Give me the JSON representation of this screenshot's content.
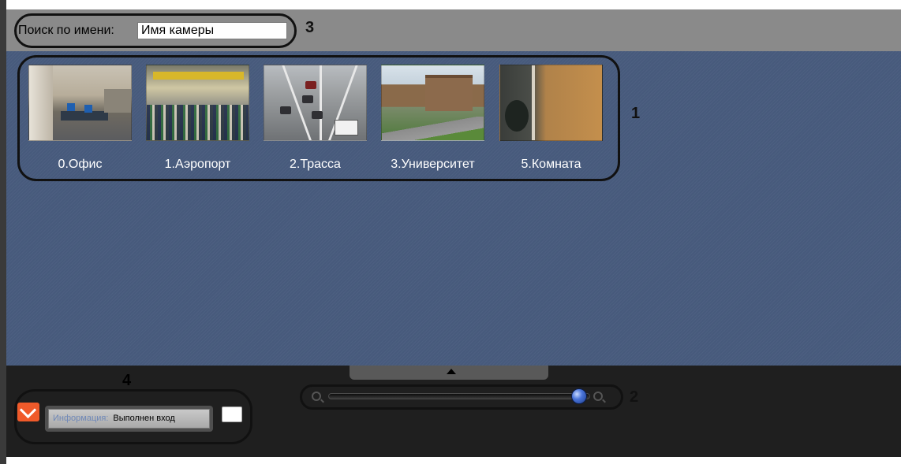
{
  "search": {
    "label": "Поиск по имени:",
    "value": "Имя камеры"
  },
  "cameras": [
    {
      "label": "0.Офис",
      "thumb": "office-camera-thumbnail"
    },
    {
      "label": "1.Аэропорт",
      "thumb": "airport-camera-thumbnail"
    },
    {
      "label": "2.Трасса",
      "thumb": "highway-camera-thumbnail"
    },
    {
      "label": "3.Университет",
      "thumb": "university-camera-thumbnail"
    },
    {
      "label": "5.Комната",
      "thumb": "room-camera-thumbnail"
    }
  ],
  "zoom": {
    "level": 0.93,
    "out_icon": "zoom-out-icon",
    "in_icon": "zoom-in-icon"
  },
  "status": {
    "key": "Информация:",
    "value": "Выполнен вход"
  },
  "callouts": {
    "one": "1",
    "two": "2",
    "three": "3",
    "four": "4"
  },
  "colors": {
    "main_background": "#475a7c",
    "toolbar": "#8a8a8a",
    "bottom_panel": "#1f1f1f",
    "mail_icon": "#f05a2a"
  }
}
